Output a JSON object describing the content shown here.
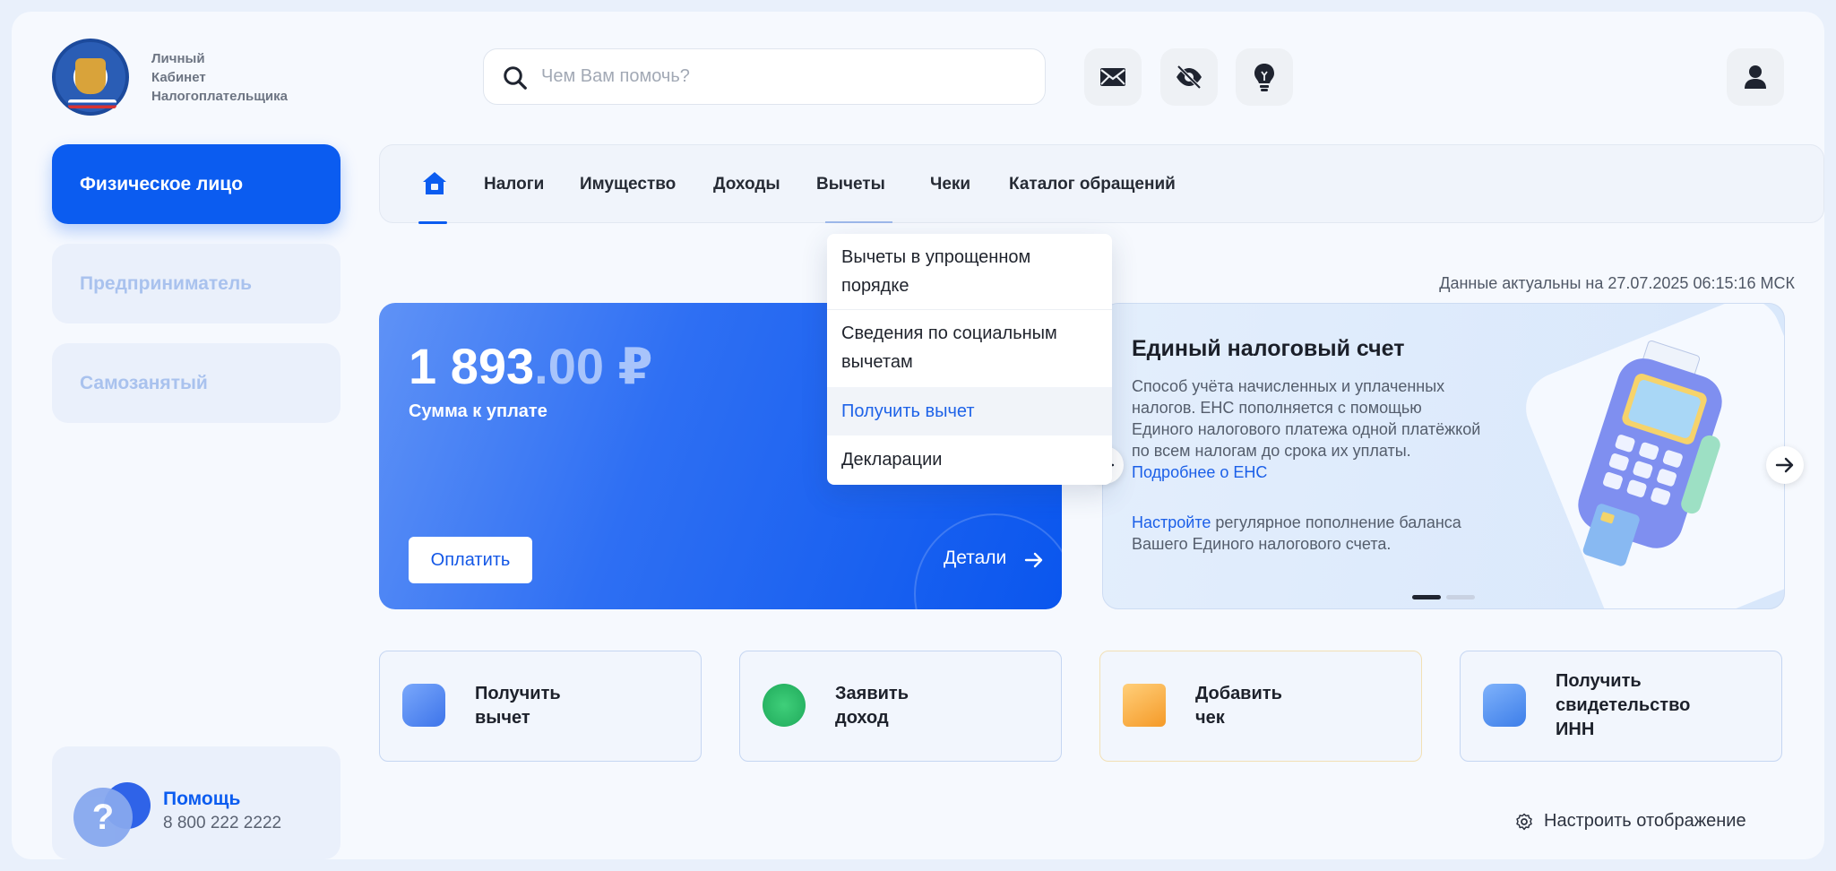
{
  "header": {
    "logo_lines": [
      "Личный",
      "Кабинет",
      "Налогоплательщика"
    ],
    "search_placeholder": "Чем Вам помочь?",
    "icons": [
      "mail-icon",
      "eye-off-icon",
      "lightbulb-icon",
      "user-icon"
    ]
  },
  "sidebar": {
    "items": [
      {
        "label": "Физическое лицо",
        "state": "active"
      },
      {
        "label": "Предприниматель",
        "state": "inactive"
      },
      {
        "label": "Самозанятый",
        "state": "inactive"
      }
    ],
    "help": {
      "title": "Помощь",
      "phone": "8 800 222 2222"
    }
  },
  "nav": {
    "items": [
      "Налоги",
      "Имущество",
      "Доходы",
      "Вычеты",
      "Чеки",
      "Каталог обращений"
    ],
    "dropdown": [
      "Вычеты в упрощенном порядке",
      "Сведения по социальным вычетам",
      "Получить вычет",
      "Декларации"
    ]
  },
  "status": {
    "updated": "Данные актуальны на 27.07.2025 06:15:16 МСК"
  },
  "pay_card": {
    "amount_int": "1 893",
    "amount_dec": ".00 ₽",
    "subtitle": "Сумма к уплате",
    "pay_button": "Оплатить",
    "details": "Детали"
  },
  "ens_card": {
    "title": "Единый налоговый счет",
    "text": "Способ учёта начисленных и уплаченных налогов. ЕНС пополняется с помощью Единого налогового платежа одной платёжкой по всем налогам до срока их уплаты.",
    "text_link": "Подробнее о ЕНС",
    "text2_link": "Настройте",
    "text2": "регулярное пополнение баланса Вашего Единого налогового счета."
  },
  "tiles": [
    {
      "lines": [
        "Получить",
        "вычет"
      ],
      "icon": "wallet-icon",
      "color": "#4f86f0"
    },
    {
      "lines": [
        "Заявить",
        "доход"
      ],
      "icon": "ruble-icon",
      "color": "#2fbf6a"
    },
    {
      "lines": [
        "Добавить",
        "чек"
      ],
      "icon": "receipt-icon",
      "color": "#f6a531"
    },
    {
      "lines": [
        "Получить",
        "свидетельство",
        "ИНН"
      ],
      "icon": "certificate-icon",
      "color": "#4a8ff0"
    }
  ],
  "footer": {
    "settings_label": "Настроить отображение"
  }
}
